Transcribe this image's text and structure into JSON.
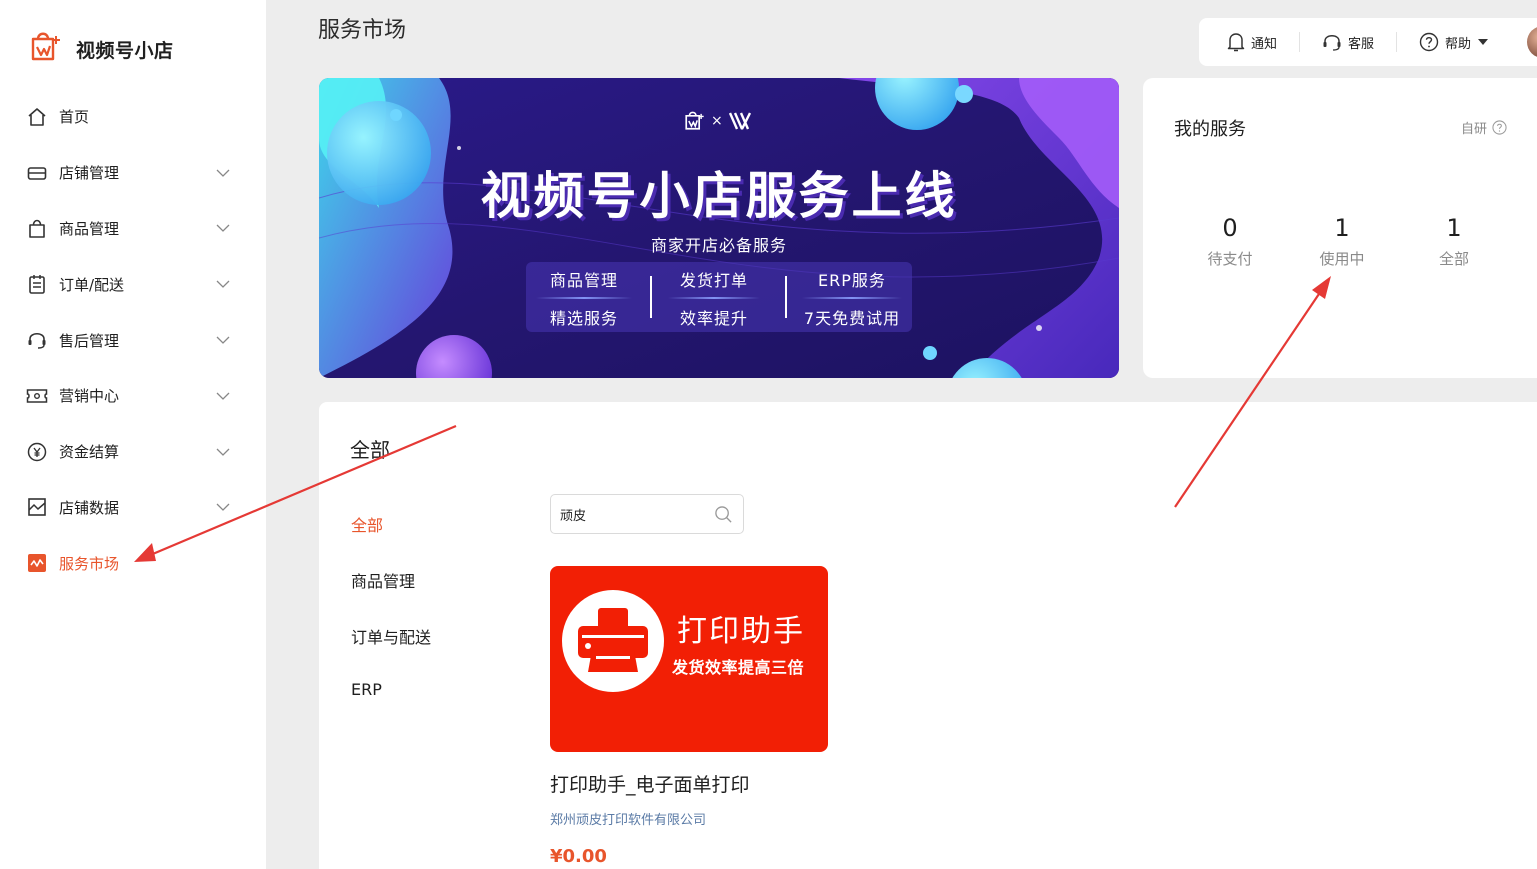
{
  "app": {
    "name": "视频号小店",
    "logo_icon": "shop-bag-icon"
  },
  "page_title": "服务市场",
  "sidebar": {
    "items": [
      {
        "label": "首页",
        "icon": "home-icon",
        "expandable": false,
        "active": false
      },
      {
        "label": "店铺管理",
        "icon": "store-icon",
        "expandable": true,
        "active": false
      },
      {
        "label": "商品管理",
        "icon": "bag-icon",
        "expandable": true,
        "active": false
      },
      {
        "label": "订单/配送",
        "icon": "clipboard-icon",
        "expandable": true,
        "active": false
      },
      {
        "label": "售后管理",
        "icon": "headset-icon",
        "expandable": true,
        "active": false
      },
      {
        "label": "营销中心",
        "icon": "ticket-icon",
        "expandable": true,
        "active": false
      },
      {
        "label": "资金结算",
        "icon": "yen-icon",
        "expandable": true,
        "active": false
      },
      {
        "label": "店铺数据",
        "icon": "chart-icon",
        "expandable": true,
        "active": false
      },
      {
        "label": "服务市场",
        "icon": "service-market-icon",
        "expandable": false,
        "active": true
      }
    ]
  },
  "toolbar": {
    "notify_label": "通知",
    "service_label": "客服",
    "help_label": "帮助"
  },
  "banner": {
    "logo_separator": "×",
    "title": "视频号小店服务上线",
    "subtitle": "商家开店必备服务",
    "columns": [
      {
        "line1": "商品管理",
        "line2": "精选服务"
      },
      {
        "line1": "发货打单",
        "line2": "效率提升"
      },
      {
        "line1": "ERP服务",
        "line2": "7天免费试用"
      }
    ]
  },
  "my_services": {
    "title": "我的服务",
    "self_label": "自研",
    "stats": [
      {
        "value": "0",
        "label": "待支付"
      },
      {
        "value": "1",
        "label": "使用中"
      },
      {
        "value": "1",
        "label": "全部"
      }
    ]
  },
  "main": {
    "heading": "全部",
    "categories": [
      {
        "label": "全部",
        "active": true
      },
      {
        "label": "商品管理",
        "active": false
      },
      {
        "label": "订单与配送",
        "active": false
      },
      {
        "label": "ERP",
        "active": false
      }
    ],
    "search": {
      "value": "顽皮",
      "placeholder": ""
    },
    "product": {
      "image_title": "打印助手",
      "image_subtitle": "发货效率提高三倍",
      "name": "打印助手_电子面单打印",
      "vendor": "郑州顽皮打印软件有限公司",
      "price": "¥0.00"
    }
  },
  "colors": {
    "accent": "#e8552c",
    "annotation_arrow": "#e53935",
    "product_bg": "#f21f05"
  }
}
